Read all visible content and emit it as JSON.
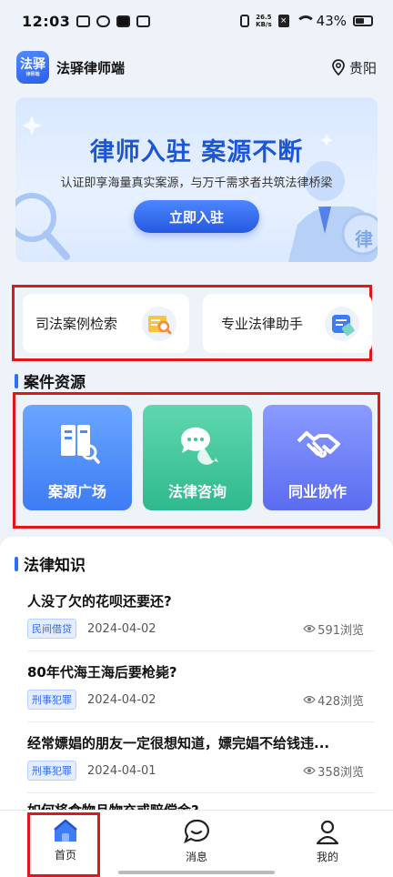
{
  "status_bar": {
    "time": "12:03",
    "net_speed": "26.5",
    "net_unit": "KB/s",
    "battery": "43%"
  },
  "header": {
    "logo_text": "法驿",
    "logo_sub": "律师端",
    "app_name": "法驿律师端",
    "location": "贵阳"
  },
  "banner": {
    "title": "律师入驻  案源不断",
    "subtitle": "认证即享海量真实案源，与万千需求者共筑法律桥梁",
    "button": "立即入驻",
    "badge_char": "律"
  },
  "tools": [
    {
      "label": "司法案例检索",
      "icon": "case-search-icon"
    },
    {
      "label": "专业法律助手",
      "icon": "legal-assistant-icon"
    }
  ],
  "case_section": {
    "title": "案件资源",
    "cards": [
      {
        "label": "案源广场",
        "icon": "case-square-icon",
        "color": "#4b8bf8"
      },
      {
        "label": "法律咨询",
        "icon": "chat-bubbles-icon",
        "color": "#3cc59a"
      },
      {
        "label": "同业协作",
        "icon": "handshake-icon",
        "color": "#6877f3"
      }
    ]
  },
  "knowledge": {
    "title": "法律知识",
    "articles": [
      {
        "title": "人没了欠的花呗还要还?",
        "tag": "民间借贷",
        "date": "2024-04-02",
        "views": "591浏览"
      },
      {
        "title": "80年代海王海后要枪毙?",
        "tag": "刑事犯罪",
        "date": "2024-04-02",
        "views": "428浏览"
      },
      {
        "title": "经常嫖娼的朋友一定很想知道，嫖完娼不给钱违...",
        "tag": "刑事犯罪",
        "date": "2024-04-01",
        "views": "358浏览"
      },
      {
        "title": "如何将食物且物充或赔偿金?"
      }
    ]
  },
  "tabbar": {
    "home": "首页",
    "messages": "消息",
    "me": "我的"
  },
  "colors": {
    "primary": "#2f6df2",
    "highlight_box": "#e0161b"
  }
}
